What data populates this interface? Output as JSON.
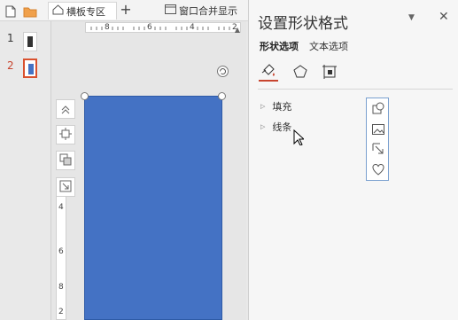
{
  "tabstrip": {
    "icons": [
      "new-doc-icon",
      "folder-icon",
      "home-icon"
    ],
    "active_tab": "横板专区",
    "new_tab_label": "+",
    "window_merge_label": "窗口合并显示"
  },
  "thumbnails": [
    {
      "number": "1",
      "selected": false
    },
    {
      "number": "2",
      "selected": true
    }
  ],
  "ruler": {
    "horizontal_labels": [
      "8",
      "6",
      "4",
      "2"
    ],
    "vertical_labels": [
      "4",
      "6",
      "8",
      "2"
    ]
  },
  "slide_shape": {
    "fill_color": "#4472c4"
  },
  "format_pane": {
    "title": "设置形状格式",
    "tabs": [
      {
        "label": "形状选项",
        "active": true
      },
      {
        "label": "文本选项",
        "active": false
      }
    ],
    "icon_tabs": [
      "fill-line-icon",
      "effects-pentagon-icon",
      "size-properties-icon"
    ],
    "sections": [
      {
        "label": "填充"
      },
      {
        "label": "线条"
      }
    ]
  },
  "colors": {
    "accent": "#c8452f",
    "shape_blue": "#4472c4"
  }
}
